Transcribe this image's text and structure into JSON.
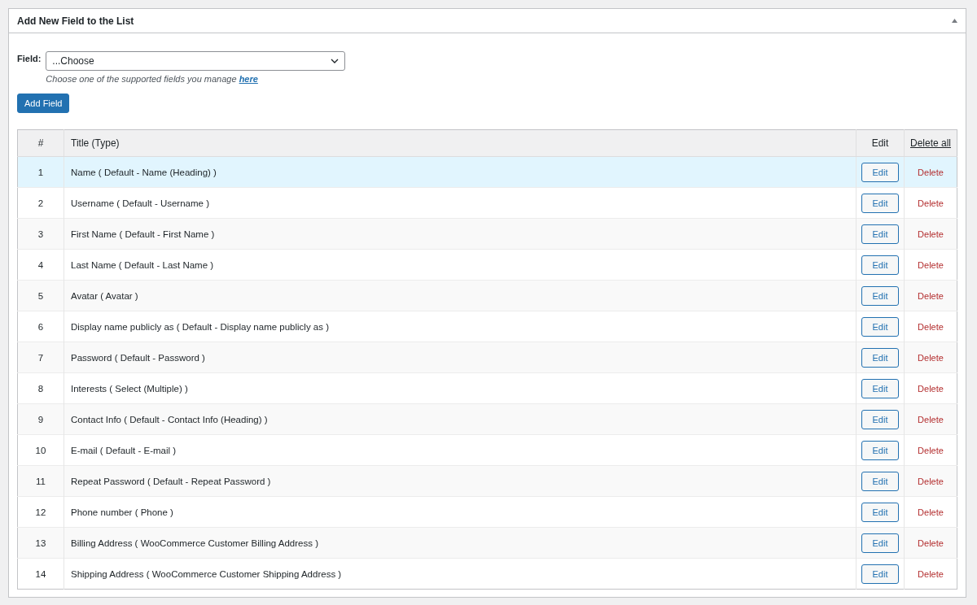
{
  "panel": {
    "title": "Add New Field to the List",
    "expanded": true
  },
  "form": {
    "label": "Field:",
    "select_value": "...Choose",
    "hint": "Choose one of the supported fields you manage ",
    "hint_link": "here",
    "button": "Add Field"
  },
  "table": {
    "columns": [
      "#",
      "Title (Type)",
      "Edit",
      "Delete all"
    ],
    "rows": [
      {
        "num": "1",
        "title": "Name ( Default - Name (Heading) )",
        "edit": "Edit",
        "delete": "Delete",
        "selected": true
      },
      {
        "num": "2",
        "title": "Username ( Default - Username )",
        "edit": "Edit",
        "delete": "Delete",
        "selected": false
      },
      {
        "num": "3",
        "title": "First Name ( Default - First Name )",
        "edit": "Edit",
        "delete": "Delete",
        "selected": false
      },
      {
        "num": "4",
        "title": "Last Name ( Default - Last Name )",
        "edit": "Edit",
        "delete": "Delete",
        "selected": false
      },
      {
        "num": "5",
        "title": "Avatar ( Avatar )",
        "edit": "Edit",
        "delete": "Delete",
        "selected": false
      },
      {
        "num": "6",
        "title": "Display name publicly as ( Default - Display name publicly as )",
        "edit": "Edit",
        "delete": "Delete",
        "selected": false
      },
      {
        "num": "7",
        "title": "Password ( Default - Password )",
        "edit": "Edit",
        "delete": "Delete",
        "selected": false
      },
      {
        "num": "8",
        "title": "Interests ( Select (Multiple) )",
        "edit": "Edit",
        "delete": "Delete",
        "selected": false
      },
      {
        "num": "9",
        "title": "Contact Info ( Default - Contact Info (Heading) )",
        "edit": "Edit",
        "delete": "Delete",
        "selected": false
      },
      {
        "num": "10",
        "title": "E-mail ( Default - E-mail )",
        "edit": "Edit",
        "delete": "Delete",
        "selected": false
      },
      {
        "num": "11",
        "title": "Repeat Password ( Default - Repeat Password )",
        "edit": "Edit",
        "delete": "Delete",
        "selected": false
      },
      {
        "num": "12",
        "title": "Phone number ( Phone )",
        "edit": "Edit",
        "delete": "Delete",
        "selected": false
      },
      {
        "num": "13",
        "title": "Billing Address ( WooCommerce Customer Billing Address )",
        "edit": "Edit",
        "delete": "Delete",
        "selected": false
      },
      {
        "num": "14",
        "title": "Shipping Address ( WooCommerce Customer Shipping Address )",
        "edit": "Edit",
        "delete": "Delete",
        "selected": false
      }
    ]
  }
}
